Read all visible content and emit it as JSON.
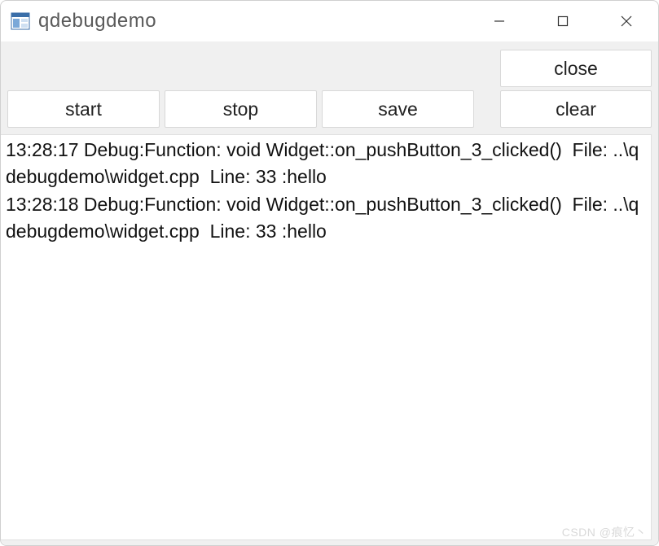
{
  "window": {
    "title": "qdebugdemo"
  },
  "buttons": {
    "close": "close",
    "clear": "clear",
    "start": "start",
    "stop": "stop",
    "save": "save"
  },
  "log": {
    "entries": [
      "13:28:17 Debug:Function: void Widget::on_pushButton_3_clicked()  File: ..\\qdebugdemo\\widget.cpp  Line: 33 :hello",
      "13:28:18 Debug:Function: void Widget::on_pushButton_3_clicked()  File: ..\\qdebugdemo\\widget.cpp  Line: 33 :hello"
    ]
  },
  "watermark": "CSDN @痕忆丶"
}
